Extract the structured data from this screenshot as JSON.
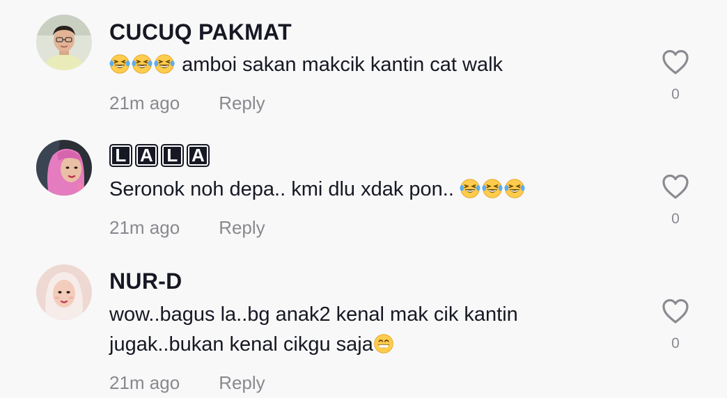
{
  "comments": [
    {
      "username": "CUCUQ PAKMAT",
      "emoji_prefix": [
        "laughing-tears-emoji",
        "laughing-tears-emoji",
        "laughing-tears-emoji"
      ],
      "text": "amboi sakan makcik kantin cat walk",
      "time": "21m ago",
      "reply_label": "Reply",
      "like_count": "0"
    },
    {
      "username_letters": [
        "L",
        "A",
        "L",
        "A"
      ],
      "text": "Seronok noh depa.. kmi dlu xdak pon..",
      "emoji_suffix": [
        "laughing-tears-emoji",
        "laughing-tears-emoji",
        "laughing-tears-emoji"
      ],
      "time": "21m ago",
      "reply_label": "Reply",
      "like_count": "0"
    },
    {
      "username": "NUR-D",
      "text_line1": "wow..bagus la..bg anak2 kenal mak cik kantin",
      "text_line2": "jugak..bukan kenal cikgu saja",
      "emoji_suffix": [
        "grinning-emoji"
      ],
      "time": "21m ago",
      "reply_label": "Reply",
      "like_count": "0"
    }
  ],
  "colors": {
    "background": "#f8f8f8",
    "text": "#161823",
    "muted": "rgba(22,24,35,0.5)",
    "emoji_face": "#ffcc4d"
  }
}
